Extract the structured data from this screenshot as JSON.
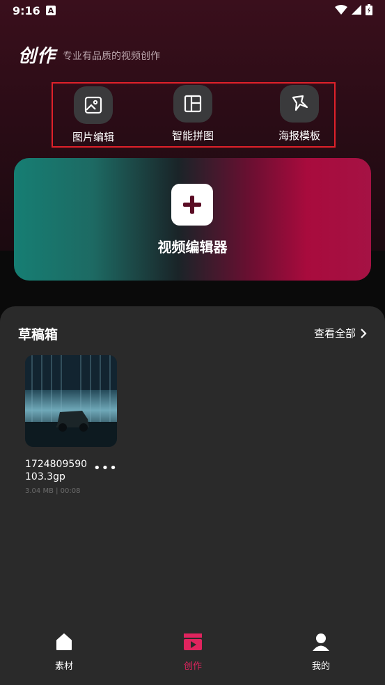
{
  "status_bar": {
    "time": "9:16",
    "badge": "A"
  },
  "header": {
    "title": "创作",
    "subtitle": "专业有品质的视频创作"
  },
  "tools": [
    {
      "label": "图片编辑",
      "icon": "image-icon"
    },
    {
      "label": "智能拼图",
      "icon": "collage-icon"
    },
    {
      "label": "海报模板",
      "icon": "poster-icon"
    }
  ],
  "editor_card": {
    "label": "视频编辑器",
    "colors": {
      "left": "#167e73",
      "right": "#a80b3d"
    }
  },
  "drafts": {
    "title": "草稿箱",
    "see_all": "查看全部",
    "items": [
      {
        "name": "1724809590\n103.3gp",
        "meta": "3.04 MB | 00:08"
      }
    ]
  },
  "bottom_nav": [
    {
      "label": "素材",
      "icon": "home-icon",
      "active": false
    },
    {
      "label": "创作",
      "icon": "clapper-icon",
      "active": true
    },
    {
      "label": "我的",
      "icon": "user-icon",
      "active": false
    }
  ],
  "accent_color": "#e0245e"
}
